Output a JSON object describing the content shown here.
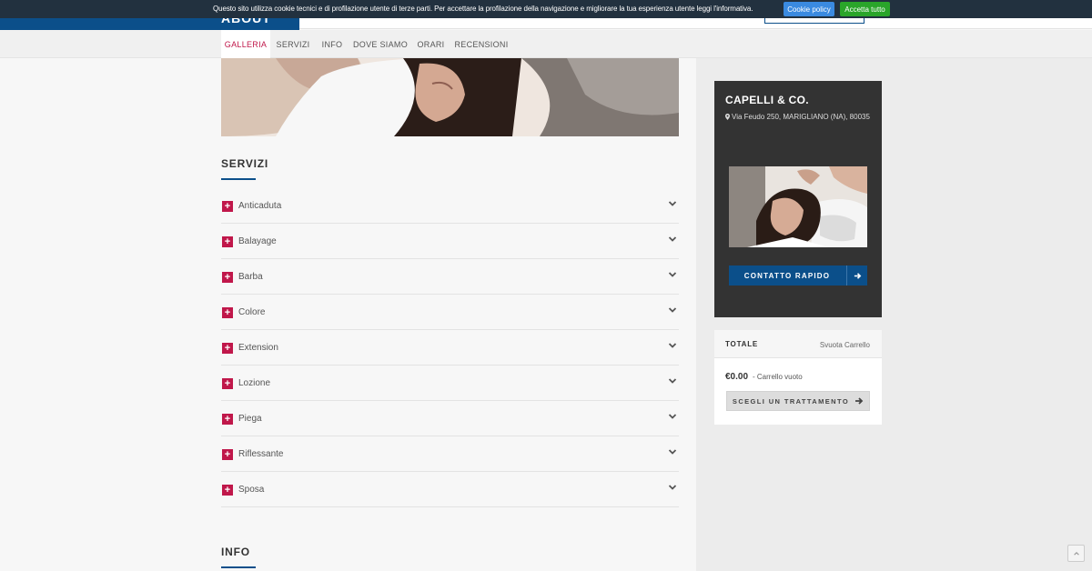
{
  "cookie_bar": {
    "text": "Questo sito utilizza cookie tecnici e di profilazione utente di terze parti. Per accettare la profilazione della navigazione e migliorare la tua esperienza utente leggi l'informativa.",
    "policy_label": "Cookie policy",
    "accept_label": "Accetta tutto"
  },
  "tabs": [
    {
      "label": "GALLERIA",
      "active": true
    },
    {
      "label": "SERVIZI"
    },
    {
      "label": "INFO"
    },
    {
      "label": "DOVE SIAMO"
    },
    {
      "label": "ORARI"
    },
    {
      "label": "RECENSIONI"
    }
  ],
  "services": {
    "title": "SERVIZI",
    "items": [
      "Anticaduta",
      "Balayage",
      "Barba",
      "Colore",
      "Extension",
      "Lozione",
      "Piega",
      "Riflessante",
      "Sposa"
    ]
  },
  "info": {
    "title": "INFO"
  },
  "shop": {
    "name": "CAPELLI & CO.",
    "address": "Via Feudo 250, MARIGLIANO (NA), 80035",
    "contact_label": "CONTATTO RAPIDO"
  },
  "cart": {
    "total_label": "TOTALE",
    "empty_link": "Svuota Carrello",
    "amount": "€0.00",
    "status": "- Carrello vuoto",
    "choose_label": "SCEGLI UN TRATTAMENTO"
  },
  "colors": {
    "brand_blue": "#0b4f8a",
    "accent_red": "#c0174a",
    "cookie_bar_bg": "#22313f",
    "policy_btn": "#3a8ae0",
    "accept_btn": "#2aa52a"
  }
}
